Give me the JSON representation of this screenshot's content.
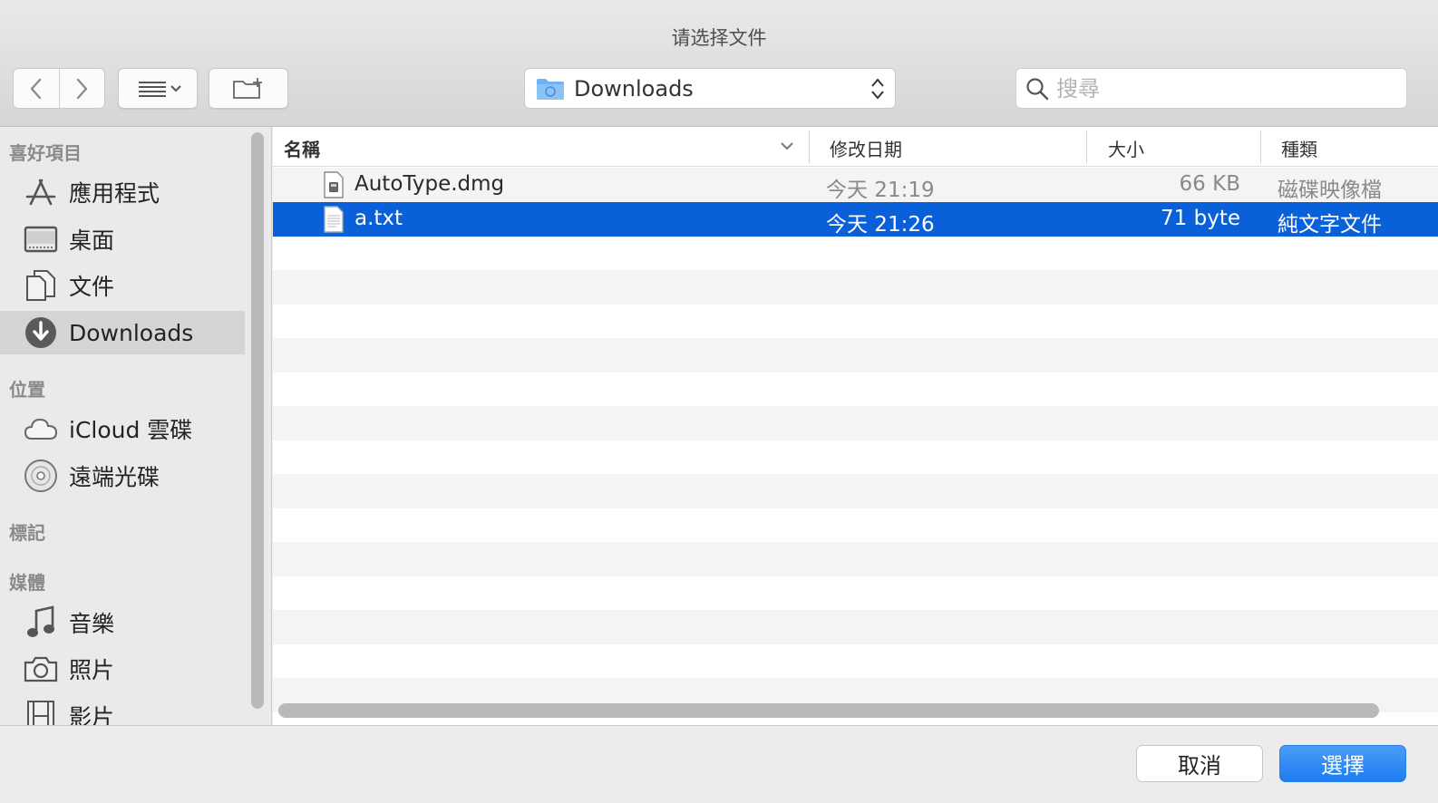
{
  "window": {
    "title": "请选择文件"
  },
  "toolbar": {
    "back_icon": "chevron-left-icon",
    "forward_icon": "chevron-right-icon",
    "view_icon": "list-view-icon",
    "new_folder_icon": "new-folder-icon",
    "location": "Downloads",
    "search_placeholder": "搜尋"
  },
  "sidebar": {
    "sections": [
      {
        "title": "喜好項目",
        "items": [
          {
            "label": "應用程式",
            "icon": "applications-icon"
          },
          {
            "label": "桌面",
            "icon": "desktop-icon"
          },
          {
            "label": "文件",
            "icon": "documents-icon"
          },
          {
            "label": "Downloads",
            "icon": "downloads-icon",
            "selected": true
          }
        ]
      },
      {
        "title": "位置",
        "items": [
          {
            "label": "iCloud 雲碟",
            "icon": "cloud-icon"
          },
          {
            "label": "遠端光碟",
            "icon": "disc-icon"
          }
        ]
      },
      {
        "title": "標記",
        "items": []
      },
      {
        "title": "媒體",
        "items": [
          {
            "label": "音樂",
            "icon": "music-icon"
          },
          {
            "label": "照片",
            "icon": "camera-icon"
          },
          {
            "label": "影片",
            "icon": "film-icon"
          }
        ]
      }
    ]
  },
  "columns": {
    "name": "名稱",
    "modified": "修改日期",
    "size": "大小",
    "kind": "種類"
  },
  "files": [
    {
      "name": "AutoType.dmg",
      "modified": "今天 21:19",
      "size": "66 KB",
      "kind": "磁碟映像檔",
      "icon": "disk-image-file-icon",
      "selected": false
    },
    {
      "name": "a.txt",
      "modified": "今天 21:26",
      "size": "71 byte",
      "kind": "純文字文件",
      "icon": "text-file-icon",
      "selected": true
    }
  ],
  "footer": {
    "cancel": "取消",
    "choose": "選擇"
  },
  "colors": {
    "selection": "#0a60d8",
    "accent": "#1d7cf2"
  }
}
